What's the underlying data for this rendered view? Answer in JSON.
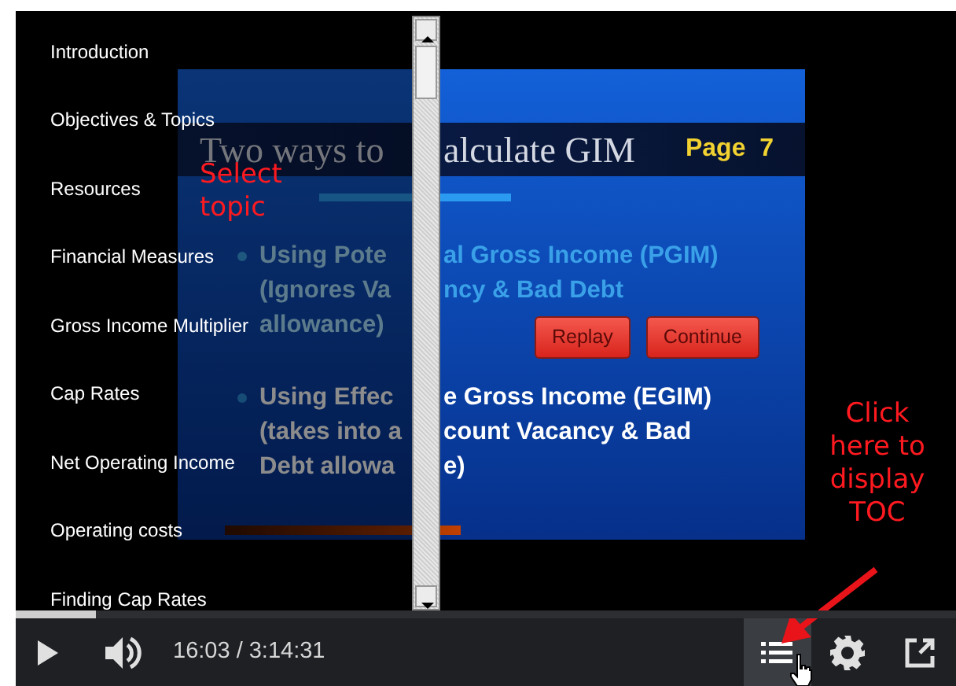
{
  "toc": {
    "items": [
      {
        "label": "Introduction"
      },
      {
        "label": "Objectives & Topics"
      },
      {
        "label": "Resources"
      },
      {
        "label": "Financial Measures"
      },
      {
        "label": "Gross Income Multiplier"
      },
      {
        "label": "Cap Rates"
      },
      {
        "label": "Net Operating Income"
      },
      {
        "label": "Operating costs"
      },
      {
        "label": "Finding Cap Rates"
      }
    ]
  },
  "slide": {
    "title": [
      "Two ways to",
      "alculate GIM"
    ],
    "page": "Page  7",
    "bullets": [
      {
        "kind": "muted",
        "lines": [
          [
            "Using Pote",
            "al Gross Income (PGIM)"
          ],
          [
            "(Ignores Va",
            "ncy & Bad Debt"
          ],
          [
            "allowance)"
          ]
        ]
      },
      {
        "kind": "bright",
        "lines": [
          [
            "Using Effec",
            "e Gross Income (EGIM)"
          ],
          [
            "(takes into a",
            "count Vacancy & Bad"
          ],
          [
            "Debt allowa",
            "e)"
          ]
        ]
      }
    ],
    "buttons": [
      "Replay",
      "Continue"
    ]
  },
  "annotations": [
    {
      "text": "Select topic",
      "kind": "toc"
    },
    {
      "text": "Click here to display TOC",
      "kind": "button"
    }
  ],
  "player": {
    "progress": {
      "level": 0.085
    },
    "time": "16:03 / 3:14:31",
    "toc_button": {
      "selected": true
    }
  }
}
